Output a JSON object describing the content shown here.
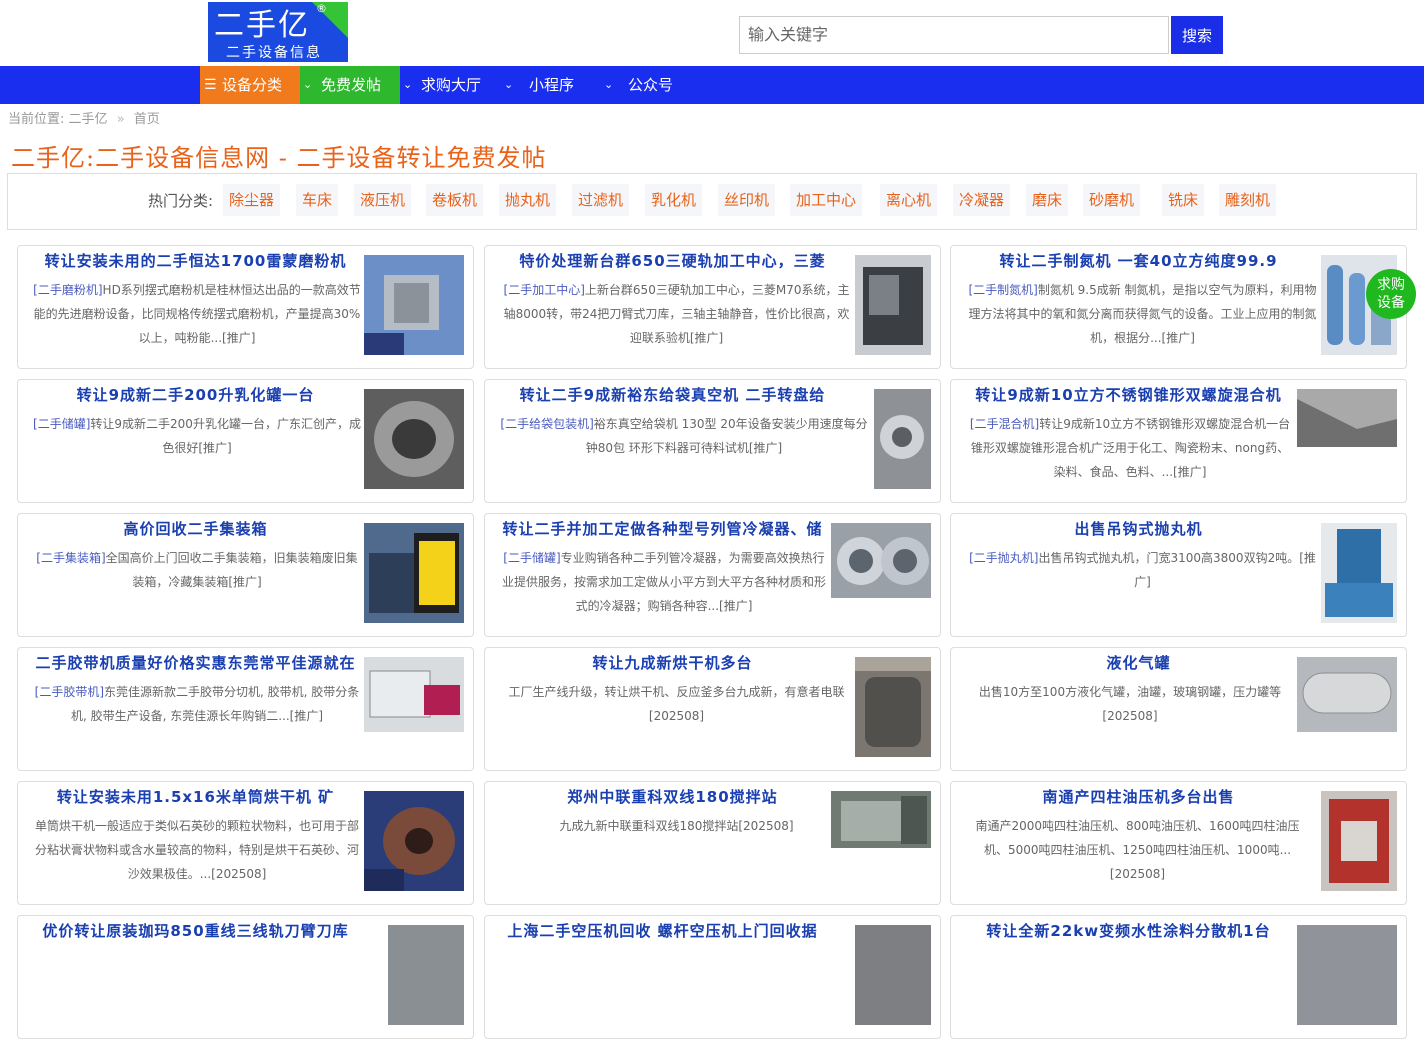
{
  "logo": {
    "main": "二手亿",
    "reg": "®",
    "sub": "二手设备信息"
  },
  "search": {
    "placeholder": "输入关键字",
    "button": "搜索"
  },
  "nav": {
    "items": [
      "设备分类",
      "免费发帖",
      "求购大厅",
      "小程序",
      "公众号"
    ]
  },
  "breadcrumb": {
    "label": "当前位置:",
    "site": "二手亿",
    "sep": "»",
    "current": "首页"
  },
  "page_title": "二手亿:二手设备信息网 - 二手设备转让免费发帖",
  "hot": {
    "label": "热门分类:",
    "tags": [
      "除尘器",
      "车床",
      "液压机",
      "卷板机",
      "抛丸机",
      "过滤机",
      "乳化机",
      "丝印机",
      "加工中心",
      "离心机",
      "冷凝器",
      "磨床",
      "砂磨机",
      "铣床",
      "雕刻机"
    ]
  },
  "float_btn": {
    "line1": "求购",
    "line2": "设备"
  },
  "cards": [
    {
      "title": "转让安装未用的二手恒达1700雷蒙磨粉机",
      "cat": "[二手磨粉机]",
      "desc": "HD系列摆式磨粉机是桂林恒达出品的一款高效节能的先进磨粉设备，比同规格传统摆式磨粉机，产量提高30%以上，吨粉能...[推广]"
    },
    {
      "title": "特价处理新台群650三硬轨加工中心，三菱",
      "cat": "[二手加工中心]",
      "desc": "上新台群650三硬轨加工中心，三菱M70系统，主轴8000转，带24把刀臂式刀库，三轴主轴静音，性价比很高，欢迎联系验机[推广]"
    },
    {
      "title": "转让二手制氮机 一套40立方纯度99.9",
      "cat": "[二手制氮机]",
      "desc": "制氮机 9.5成新 制氮机，是指以空气为原料，利用物理方法将其中的氧和氮分离而获得氮气的设备。工业上应用的制氮机，根据分...[推广]"
    },
    {
      "title": "转让9成新二手200升乳化罐一台",
      "cat": "[二手储罐]",
      "desc": "转让9成新二手200升乳化罐一台，广东汇创产，成色很好[推广]"
    },
    {
      "title": "转让二手9成新裕东给袋真空机 二手转盘给",
      "cat": "[二手给袋包装机]",
      "desc": "裕东真空给袋机 130型 20年设备安装少用速度每分钟80包 环形下料器可待料试机[推广]"
    },
    {
      "title": "转让9成新10立方不锈钢锥形双螺旋混合机",
      "cat": "[二手混合机]",
      "desc": "转让9成新10立方不锈钢锥形双螺旋混合机一台 锥形双螺旋锥形混合机广泛用于化工、陶瓷粉末、nong药、染料、食品、色料、...[推广]"
    },
    {
      "title": "高价回收二手集装箱",
      "cat": "[二手集装箱]",
      "desc": "全国高价上门回收二手集装箱，旧集装箱废旧集装箱，冷藏集装箱[推广]"
    },
    {
      "title": "转让二手并加工定做各种型号列管冷凝器、储",
      "cat": "[二手储罐]",
      "desc": "专业购销各种二手列管冷凝器，为需要高效换热行业提供服务，按需求加工定做从小平方到大平方各种材质和形式的冷凝器；购销各种容...[推广]"
    },
    {
      "title": "出售吊钩式抛丸机",
      "cat": "[二手抛丸机]",
      "desc": "出售吊钩式抛丸机，门宽3100高3800双钩2吨。[推广]"
    },
    {
      "title": "二手胶带机质量好价格实惠东莞常平佳源就在",
      "cat": "[二手胶带机]",
      "desc": "东莞佳源新款二手胶带分切机, 胶带机, 胶带分条机, 胶带生产设备, 东莞佳源长年购销二...[推广]"
    },
    {
      "title": "转让九成新烘干机多台",
      "cat": "",
      "desc": "工厂生产线升级，转让烘干机、反应釜多台九成新，有意者电联[202508]"
    },
    {
      "title": "液化气罐",
      "cat": "",
      "desc": "出售10方至100方液化气罐，油罐，玻璃钢罐，压力罐等[202508]"
    },
    {
      "title": "转让安装未用1.5x16米单筒烘干机 矿",
      "cat": "",
      "desc": "单筒烘干机一般适应于类似石英砂的颗粒状物料，也可用于部分粘状膏状物料或含水量较高的物料，特别是烘干石英砂、河沙效果极佳。...[202508]"
    },
    {
      "title": "郑州中联重科双线180搅拌站",
      "cat": "",
      "desc": "九成九新中联重科双线180搅拌站[202508]"
    },
    {
      "title": "南通产四柱油压机多台出售",
      "cat": "",
      "desc": "南通产2000吨四柱油压机、800吨油压机、1600吨四柱油压机、5000吨四柱油压机、1250吨四柱油压机、1000吨...[202508]"
    },
    {
      "title": "优价转让原装珈玛850重线三线轨刀臂刀库",
      "cat": "",
      "desc": ""
    },
    {
      "title": "上海二手空压机回收 螺杆空压机上门回收据",
      "cat": "",
      "desc": ""
    },
    {
      "title": "转让全新22kw变频水性涂料分散机1台",
      "cat": "",
      "desc": ""
    }
  ],
  "colors": {
    "nav_bg": "#1a2ef0",
    "accent_orange": "#f07a1c",
    "accent_green": "#2db82d",
    "title_blue": "#1a3fb0",
    "title_orange": "#e8621a"
  }
}
